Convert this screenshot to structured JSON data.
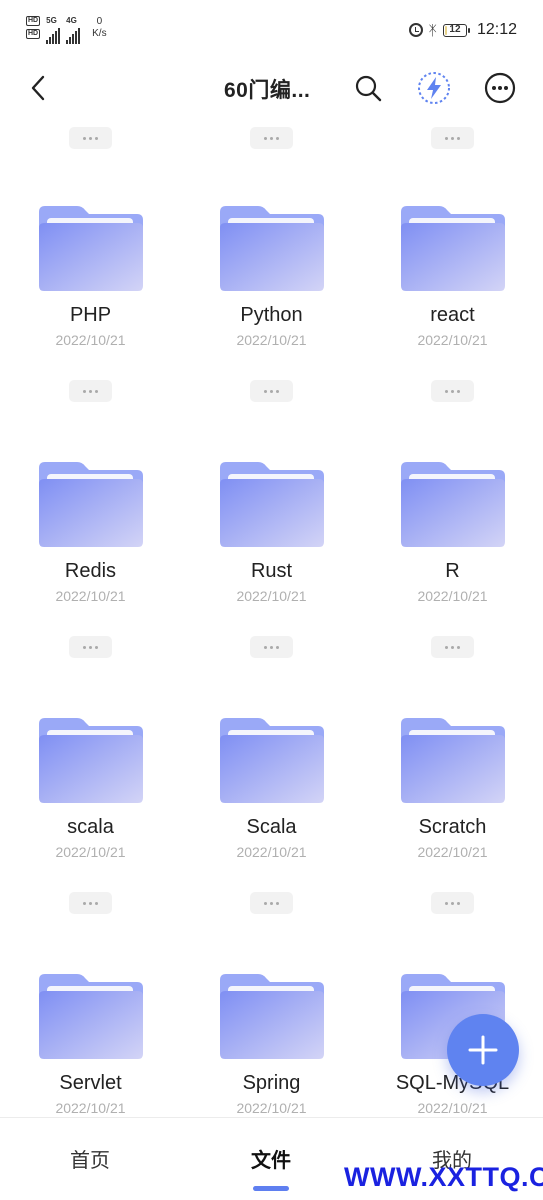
{
  "status_bar": {
    "sim1_label": "HD",
    "sim2_label": "HD",
    "net1_label": "5G",
    "net2_label": "4G",
    "speed_value": "0",
    "speed_unit": "K/s",
    "battery_level": "12",
    "time": "12:12"
  },
  "header": {
    "title": "60门编..."
  },
  "folders": {
    "top_partial_count": 3,
    "items": [
      {
        "name": "PHP",
        "date": "2022/10/21"
      },
      {
        "name": "Python",
        "date": "2022/10/21"
      },
      {
        "name": "react",
        "date": "2022/10/21"
      },
      {
        "name": "Redis",
        "date": "2022/10/21"
      },
      {
        "name": "Rust",
        "date": "2022/10/21"
      },
      {
        "name": "R",
        "date": "2022/10/21"
      },
      {
        "name": "scala",
        "date": "2022/10/21"
      },
      {
        "name": "Scala",
        "date": "2022/10/21"
      },
      {
        "name": "Scratch",
        "date": "2022/10/21"
      },
      {
        "name": "Servlet",
        "date": "2022/10/21"
      },
      {
        "name": "Spring",
        "date": "2022/10/21"
      },
      {
        "name": "SQL-MySQL",
        "date": "2022/10/21"
      }
    ]
  },
  "bottom_nav": {
    "items": [
      {
        "label": "首页",
        "active": false
      },
      {
        "label": "文件",
        "active": true
      },
      {
        "label": "我的",
        "active": false
      }
    ]
  },
  "watermark": "WWW.XXTTQ.COM",
  "colors": {
    "accent": "#5f83f0",
    "folder_back": "#9aa9f7",
    "folder_front_start": "#7f8ff3",
    "folder_front_end": "#d3d4f6"
  }
}
